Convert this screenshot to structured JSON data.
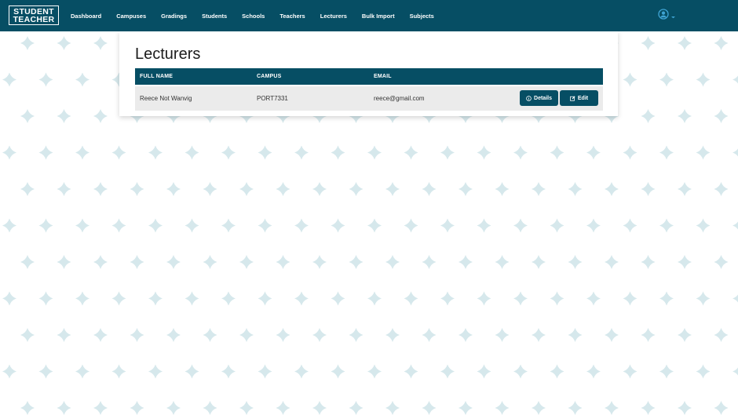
{
  "brand": {
    "line1": "STUDENT",
    "line2": "TEACHER"
  },
  "nav": {
    "items": [
      {
        "label": "Dashboard"
      },
      {
        "label": "Campuses"
      },
      {
        "label": "Gradings"
      },
      {
        "label": "Students"
      },
      {
        "label": "Schools"
      },
      {
        "label": "Teachers"
      },
      {
        "label": "Lecturers"
      },
      {
        "label": "Bulk Import"
      },
      {
        "label": "Subjects"
      }
    ],
    "user_icon": "user-circle-icon",
    "caret_icon": "chevron-down-icon"
  },
  "page": {
    "title": "Lecturers"
  },
  "table": {
    "columns": [
      "FULL NAME",
      "CAMPUS",
      "EMAIL"
    ],
    "rows": [
      {
        "full_name": "Reece Not Wanvig",
        "campus": "PORT7331",
        "email": "reece@gmail.com",
        "details_label": "Details",
        "edit_label": "Edit"
      }
    ]
  },
  "colors": {
    "primary": "#064e64",
    "pattern": "#d6e8ec",
    "row_bg": "#ebebeb"
  }
}
